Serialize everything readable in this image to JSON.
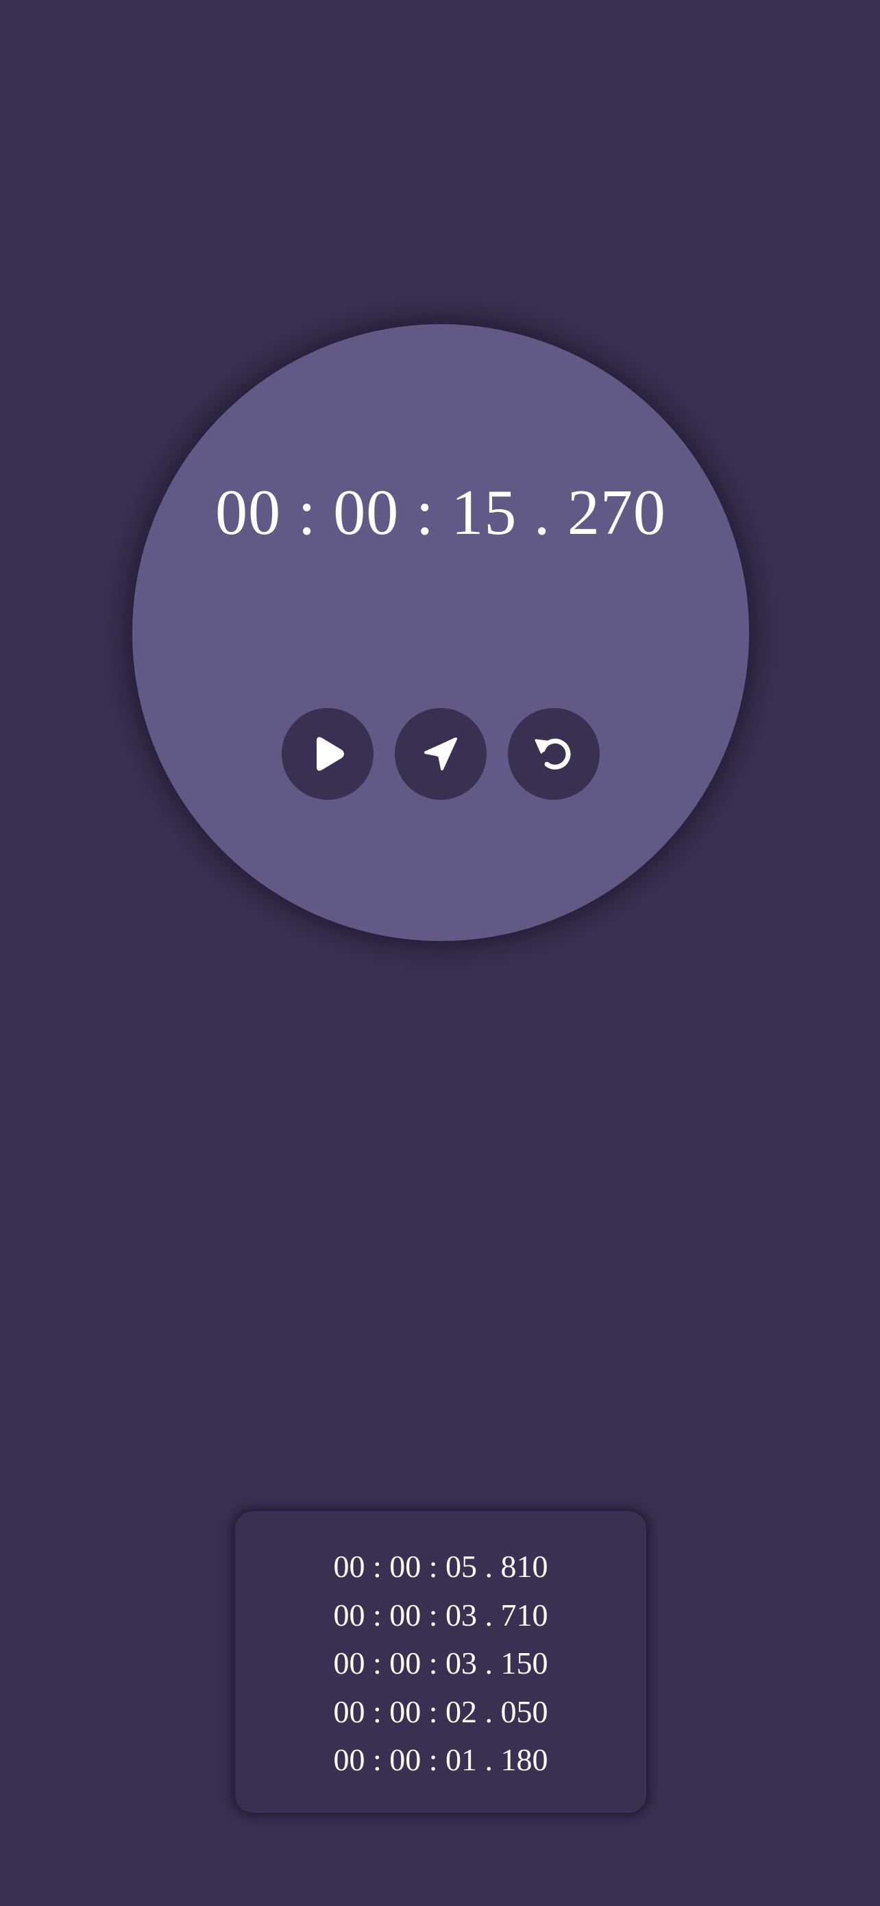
{
  "stopwatch": {
    "time": "00 : 00 : 15 . 270",
    "buttons": {
      "start_icon": "play-icon",
      "lap_icon": "navigation-arrow-icon",
      "reset_icon": "reset-icon"
    }
  },
  "laps": [
    "00 : 00 : 05 . 810",
    "00 : 00 : 03 . 710",
    "00 : 00 : 03 . 150",
    "00 : 00 : 02 . 050",
    "00 : 00 : 01 . 180"
  ],
  "colors": {
    "background": "#3a3052",
    "face": "#625a86",
    "button": "#3a3052",
    "text": "#ffffff"
  }
}
